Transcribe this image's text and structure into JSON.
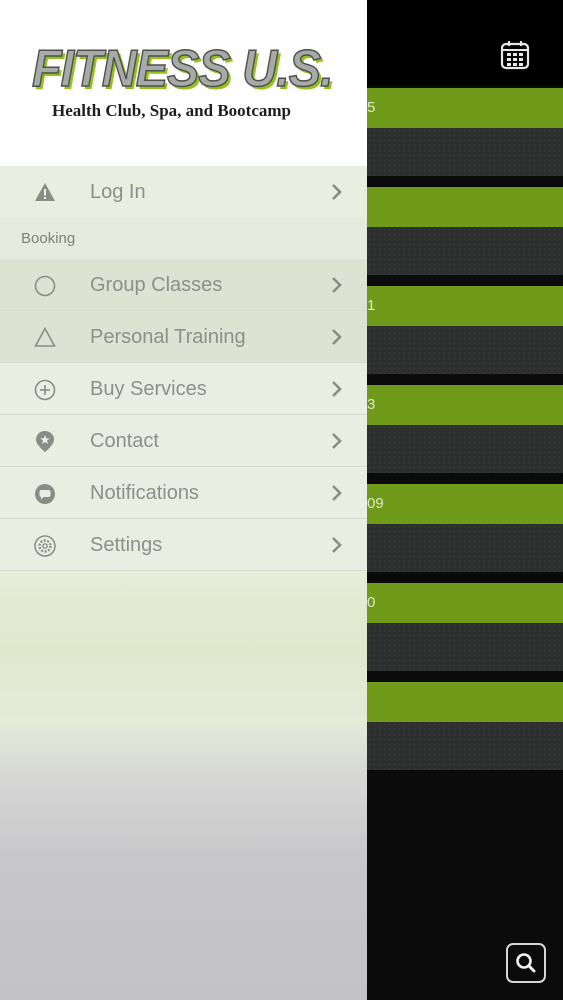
{
  "app": {
    "logo_title": "FITNESS U.S.",
    "logo_subtitle": "Health Club, Spa, and Bootcamp"
  },
  "drawer": {
    "login": {
      "label": "Log In",
      "icon": "warning-icon"
    },
    "section_title": "Booking",
    "items": [
      {
        "label": "Group Classes",
        "icon": "circle-icon"
      },
      {
        "label": "Personal Training",
        "icon": "triangle-icon"
      },
      {
        "label": "Buy Services",
        "icon": "plus-circle-icon"
      },
      {
        "label": "Contact",
        "icon": "location-pin-icon"
      },
      {
        "label": "Notifications",
        "icon": "chat-bubble-icon"
      },
      {
        "label": "Settings",
        "icon": "gear-icon"
      }
    ]
  },
  "background": {
    "header_icon": "calendar-icon",
    "green_band_labels": [
      "5",
      "",
      "1",
      "3",
      "09",
      "0",
      ""
    ],
    "search_icon": "search-icon"
  },
  "colors": {
    "accent_green": "#6f9a1a",
    "logo_green": "#93c21d",
    "text_gray": "#8d8f8b"
  }
}
